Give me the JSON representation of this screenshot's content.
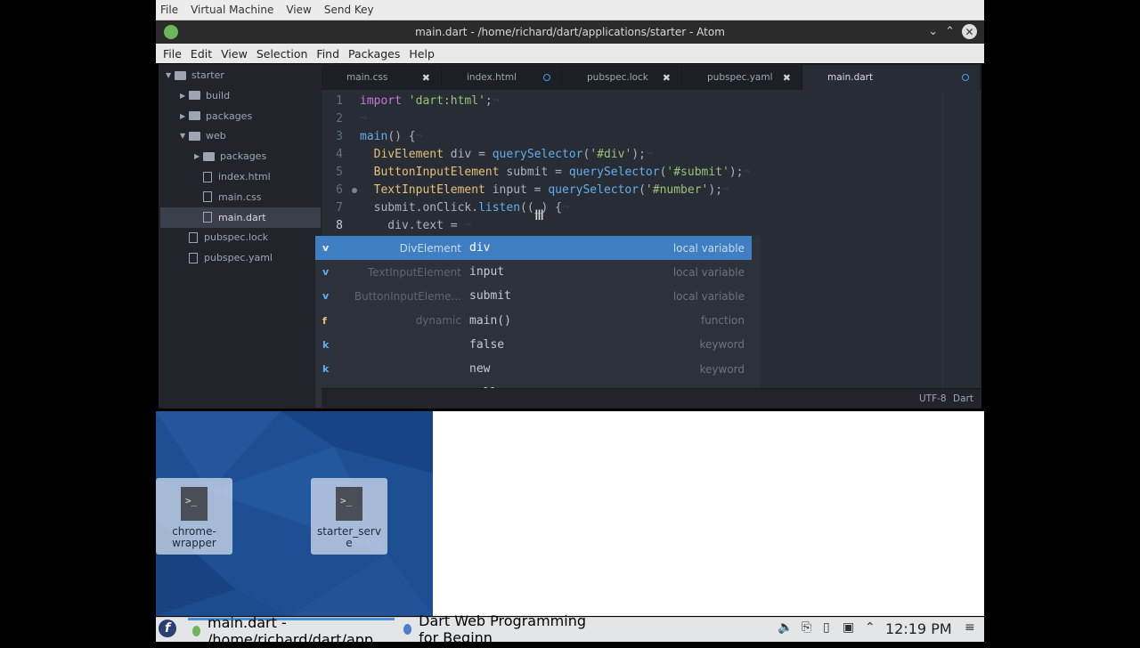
{
  "vm_menu": [
    "File",
    "Virtual Machine",
    "View",
    "Send Key"
  ],
  "window": {
    "title": "main.dart - /home/richard/dart/applications/starter - Atom"
  },
  "app_menu": [
    "File",
    "Edit",
    "View",
    "Selection",
    "Find",
    "Packages",
    "Help"
  ],
  "tree": {
    "items": [
      {
        "label": "starter",
        "kind": "folder",
        "depth": 0,
        "open": true
      },
      {
        "label": "build",
        "kind": "folder",
        "depth": 1,
        "open": false
      },
      {
        "label": "packages",
        "kind": "folder",
        "depth": 1,
        "open": false
      },
      {
        "label": "web",
        "kind": "folder",
        "depth": 1,
        "open": true
      },
      {
        "label": "packages",
        "kind": "folder",
        "depth": 2,
        "open": false
      },
      {
        "label": "index.html",
        "kind": "file",
        "depth": 2
      },
      {
        "label": "main.css",
        "kind": "file",
        "depth": 2
      },
      {
        "label": "main.dart",
        "kind": "file",
        "depth": 2,
        "selected": true
      },
      {
        "label": "pubspec.lock",
        "kind": "file",
        "depth": 1
      },
      {
        "label": "pubspec.yaml",
        "kind": "file",
        "depth": 1
      }
    ]
  },
  "tabs": [
    {
      "label": "main.css",
      "state": "close"
    },
    {
      "label": "index.html",
      "state": "modified"
    },
    {
      "label": "pubspec.lock",
      "state": "close"
    },
    {
      "label": "pubspec.yaml",
      "state": "close"
    },
    {
      "label": "main.dart",
      "state": "modified",
      "active": true
    }
  ],
  "editor": {
    "line_numbers": [
      "1",
      "2",
      "3",
      "4",
      "5",
      "6",
      "7",
      "8"
    ],
    "current_line": "8",
    "lines": [
      [
        {
          "t": "import",
          "c": "kw"
        },
        {
          "t": " "
        },
        {
          "t": "'dart:html'",
          "c": "str"
        },
        {
          "t": ";"
        },
        {
          "t": "¬",
          "c": "inv"
        }
      ],
      [
        {
          "t": "¬",
          "c": "inv"
        }
      ],
      [
        {
          "t": "main",
          "c": "fn"
        },
        {
          "t": "() {"
        },
        {
          "t": "¬",
          "c": "inv"
        }
      ],
      [
        {
          "t": "  "
        },
        {
          "t": "DivElement",
          "c": "ty"
        },
        {
          "t": " div = "
        },
        {
          "t": "querySelector",
          "c": "fn"
        },
        {
          "t": "("
        },
        {
          "t": "'#div'",
          "c": "str"
        },
        {
          "t": ");"
        },
        {
          "t": "¬",
          "c": "inv"
        }
      ],
      [
        {
          "t": "  "
        },
        {
          "t": "ButtonInputElement",
          "c": "ty"
        },
        {
          "t": " submit = "
        },
        {
          "t": "querySelector",
          "c": "fn"
        },
        {
          "t": "("
        },
        {
          "t": "'#submit'",
          "c": "str"
        },
        {
          "t": ");"
        },
        {
          "t": "¬",
          "c": "inv"
        }
      ],
      [
        {
          "t": "  "
        },
        {
          "t": "TextInputElement",
          "c": "ty"
        },
        {
          "t": " input = "
        },
        {
          "t": "querySelector",
          "c": "fn"
        },
        {
          "t": "("
        },
        {
          "t": "'#number'",
          "c": "str"
        },
        {
          "t": ");"
        },
        {
          "t": "¬",
          "c": "inv"
        }
      ],
      [
        {
          "t": "  submit.onClick."
        },
        {
          "t": "listen",
          "c": "fn"
        },
        {
          "t": "((_) {"
        },
        {
          "t": "¬",
          "c": "inv"
        }
      ],
      [
        {
          "t": "    div.text = "
        },
        {
          "t": "¬",
          "c": "inv"
        }
      ]
    ]
  },
  "autocomplete": [
    {
      "badge": "v",
      "left": "DivElement",
      "word": "div",
      "right": "local variable",
      "selected": true
    },
    {
      "badge": "v",
      "left": "TextInputElement",
      "word": "input",
      "right": "local variable"
    },
    {
      "badge": "v",
      "left": "ButtonInputEleme...",
      "word": "submit",
      "right": "local variable"
    },
    {
      "badge": "f",
      "left": "dynamic",
      "word": "main()",
      "right": "function"
    },
    {
      "badge": "k",
      "left": "",
      "word": "false",
      "right": "keyword"
    },
    {
      "badge": "k",
      "left": "",
      "word": "new",
      "right": "keyword"
    },
    {
      "badge": "k",
      "left": "",
      "word": "null",
      "right": "keyword"
    }
  ],
  "badge_colors": {
    "v": "#61afef",
    "f": "#e5c07b",
    "k": "#61afef"
  },
  "status_bar": {
    "encoding": "UTF-8",
    "grammar": "Dart"
  },
  "desktop": {
    "icons": [
      {
        "label": "chrome-\nwrapper",
        "glyph": ">_"
      },
      {
        "label": "starter_serv\ne",
        "glyph": ">_"
      }
    ]
  },
  "taskbar": {
    "tasks": [
      {
        "label": "main.dart - /home/richard/dart/app",
        "icon_color": "#6eb65c"
      },
      {
        "label": "Dart Web Programming for Beginn",
        "icon_color": "#4a7fd0"
      }
    ],
    "clock": "12:19 PM"
  }
}
